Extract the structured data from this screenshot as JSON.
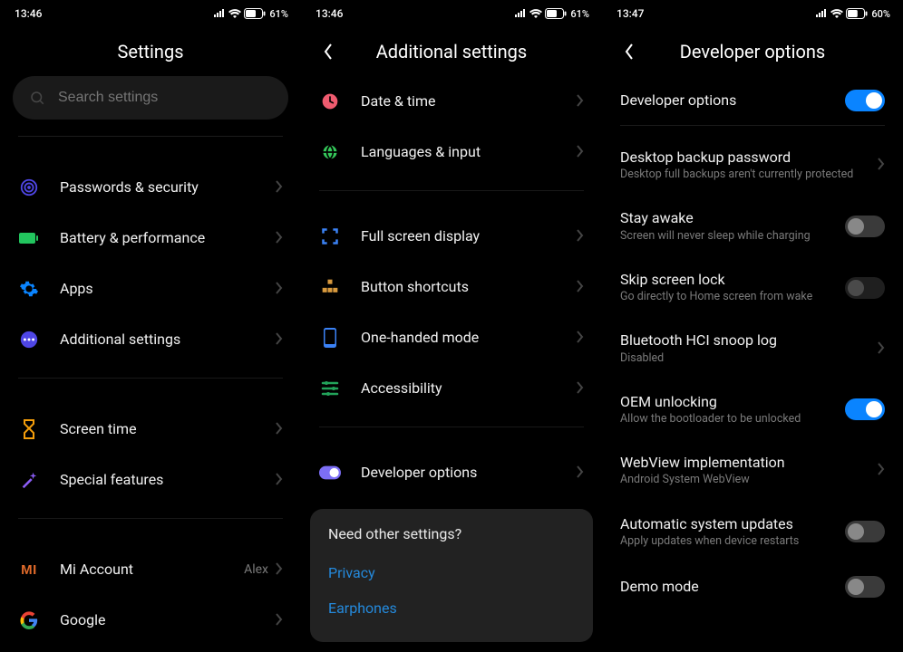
{
  "pane1": {
    "status": {
      "time": "13:46",
      "battery": "61%"
    },
    "title": "Settings",
    "search_placeholder": "Search settings",
    "groups": [
      [
        {
          "key": "passwords",
          "label": "Passwords & security",
          "icon": "target",
          "color": "#4f46e5"
        },
        {
          "key": "battery",
          "label": "Battery & performance",
          "icon": "battery",
          "color": "#22c55e"
        },
        {
          "key": "apps",
          "label": "Apps",
          "icon": "gear",
          "color": "#0a84ff"
        },
        {
          "key": "additional",
          "label": "Additional settings",
          "icon": "dots",
          "color": "#4f46e5"
        }
      ],
      [
        {
          "key": "screentime",
          "label": "Screen time",
          "icon": "hourglass",
          "color": "#f59e0b"
        },
        {
          "key": "special",
          "label": "Special features",
          "icon": "wand",
          "color": "#8b5cf6"
        }
      ],
      [
        {
          "key": "mi-account",
          "label": "Mi Account",
          "icon": "mi",
          "color": "#e06a2a",
          "trail": "Alex"
        },
        {
          "key": "google",
          "label": "Google",
          "icon": "google",
          "color": "#ffffff"
        }
      ]
    ]
  },
  "pane2": {
    "status": {
      "time": "13:46",
      "battery": "61%"
    },
    "title": "Additional settings",
    "groups": [
      [
        {
          "key": "datetime",
          "label": "Date & time",
          "icon": "clock",
          "color": "#ef5b6f"
        },
        {
          "key": "lang",
          "label": "Languages & input",
          "icon": "globe",
          "color": "#34c759"
        }
      ],
      [
        {
          "key": "fullscreen",
          "label": "Full screen display",
          "icon": "corners",
          "color": "#3b82f6"
        },
        {
          "key": "buttons",
          "label": "Button shortcuts",
          "icon": "blocks",
          "color": "#d89a3e"
        },
        {
          "key": "onehand",
          "label": "One-handed mode",
          "icon": "phone",
          "color": "#3b82f6"
        },
        {
          "key": "a11y",
          "label": "Accessibility",
          "icon": "sliders",
          "color": "#22a35a"
        }
      ],
      [
        {
          "key": "dev",
          "label": "Developer options",
          "icon": "toggle",
          "color": "#7c6ef6"
        }
      ]
    ],
    "card": {
      "title": "Need other settings?",
      "links": [
        "Privacy",
        "Earphones"
      ]
    }
  },
  "pane3": {
    "status": {
      "time": "13:47",
      "battery": "60%"
    },
    "title": "Developer options",
    "items": [
      {
        "key": "dev-master",
        "label": "Developer options",
        "type": "toggle",
        "state": "on"
      },
      {
        "key": "divider"
      },
      {
        "key": "desktop-backup",
        "label": "Desktop backup password",
        "sub": "Desktop full backups aren't currently protected",
        "type": "chevron"
      },
      {
        "key": "stay-awake",
        "label": "Stay awake",
        "sub": "Screen will never sleep while charging",
        "type": "toggle",
        "state": "off"
      },
      {
        "key": "skip-lock",
        "label": "Skip screen lock",
        "sub": "Go directly to Home screen from wake",
        "type": "toggle",
        "state": "off",
        "disabled": true
      },
      {
        "key": "bt-snoop",
        "label": "Bluetooth HCI snoop log",
        "sub": "Disabled",
        "type": "chevron"
      },
      {
        "key": "oem",
        "label": "OEM unlocking",
        "sub": "Allow the bootloader to be unlocked",
        "type": "toggle",
        "state": "on"
      },
      {
        "key": "webview",
        "label": "WebView implementation",
        "sub": "Android System WebView",
        "type": "chevron"
      },
      {
        "key": "auto-update",
        "label": "Automatic system updates",
        "sub": "Apply updates when device restarts",
        "type": "toggle",
        "state": "off"
      },
      {
        "key": "demo",
        "label": "Demo mode",
        "type": "toggle",
        "state": "off"
      }
    ]
  }
}
